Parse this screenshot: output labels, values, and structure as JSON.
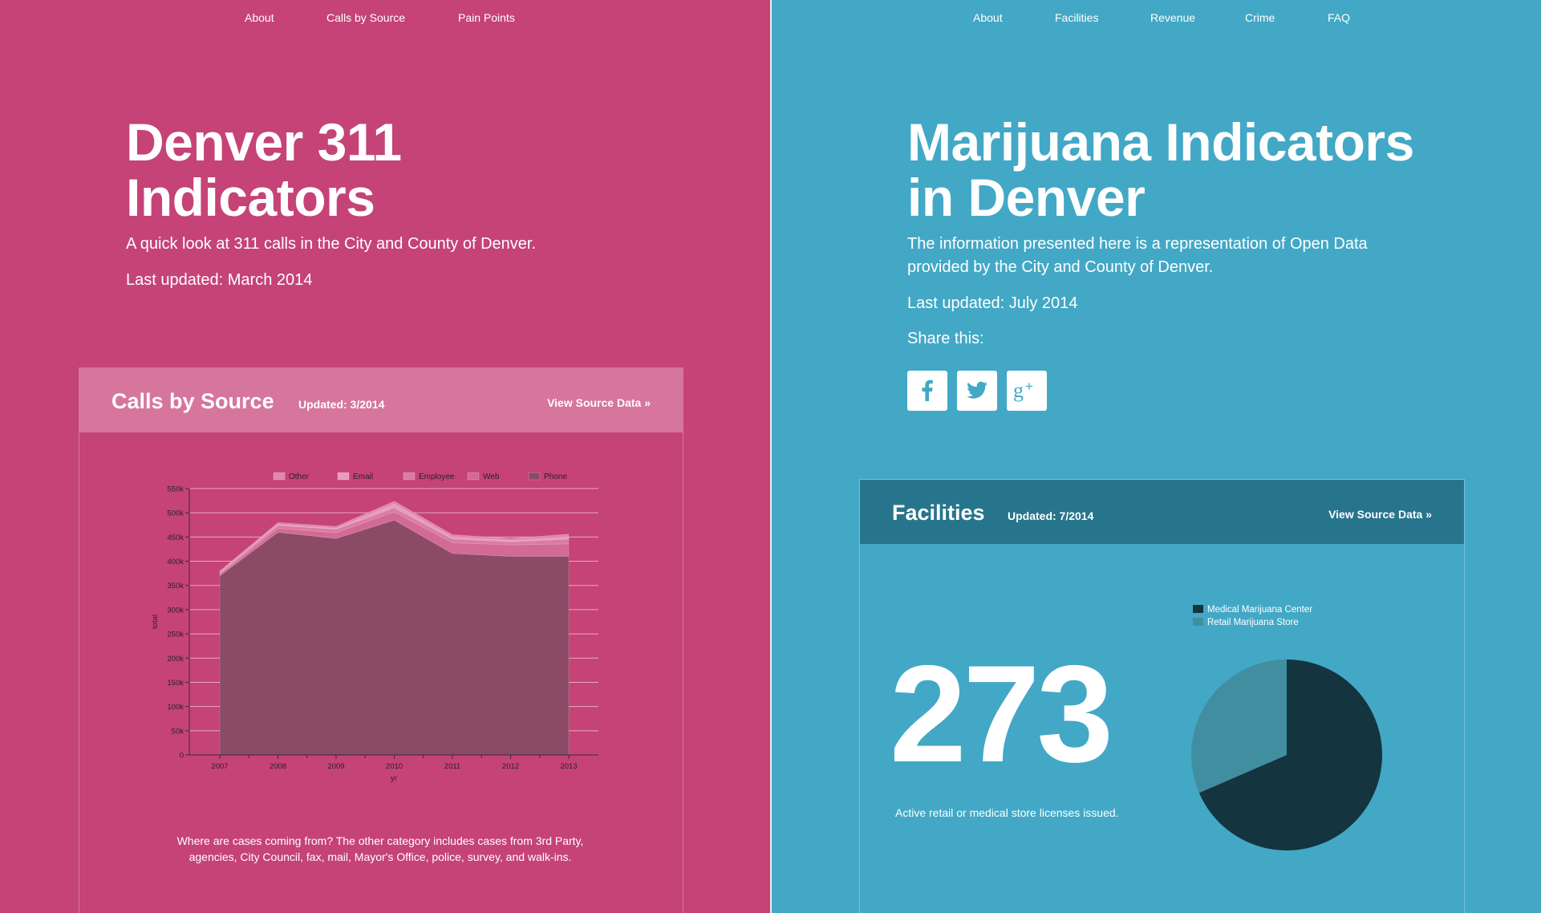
{
  "left": {
    "nav": [
      "About",
      "Calls by Source",
      "Pain Points"
    ],
    "title_line1": "Denver 311",
    "title_line2": "Indicators",
    "description": "A quick look at 311 calls in the City and County of Denver.",
    "last_updated": "Last updated: March 2014",
    "card": {
      "title": "Calls by Source",
      "updated": "Updated: 3/2014",
      "link": "View Source Data »",
      "caption": "Where are cases coming from? The other category includes cases from 3rd Party, agencies, City Council, fax, mail, Mayor's Office, police, survey, and walk-ins."
    }
  },
  "right": {
    "nav": [
      "About",
      "Facilities",
      "Revenue",
      "Crime",
      "FAQ"
    ],
    "title_line1": "Marijuana Indicators",
    "title_line2": "in Denver",
    "description": "The information presented here is a representation of Open Data provided by the City and County of Denver.",
    "last_updated": "Last updated: July 2014",
    "share_label": "Share this:",
    "share_buttons": [
      "facebook-icon",
      "twitter-icon",
      "google-plus-icon"
    ],
    "card": {
      "title": "Facilities",
      "updated": "Updated: 7/2014",
      "link": "View Source Data »",
      "big_number": "273",
      "big_number_caption": "Active retail or medical store licenses issued."
    }
  },
  "colors": {
    "left_bg": "#c54376",
    "right_bg": "#42a8c6",
    "left_card_header": "#d6769c",
    "right_card_header": "#27758c",
    "phone": "#8b4b65",
    "web": "#d36a95",
    "employee": "#da7ca1",
    "email": "#e79cbd",
    "other": "#de88ac",
    "medical": "#14343f",
    "retail": "#428ea1"
  },
  "chart_data": [
    {
      "type": "area",
      "stacked": true,
      "x": [
        "2007",
        "2008",
        "2009",
        "2010",
        "2011",
        "2012",
        "2013"
      ],
      "series": [
        {
          "name": "Phone",
          "values": [
            370000,
            460000,
            447000,
            485000,
            416000,
            410000,
            410000
          ]
        },
        {
          "name": "Web",
          "values": [
            3000,
            8000,
            12000,
            17000,
            22000,
            24000,
            26000
          ]
        },
        {
          "name": "Employee",
          "values": [
            3000,
            6000,
            7000,
            8000,
            8000,
            6000,
            10000
          ]
        },
        {
          "name": "Email",
          "values": [
            1000,
            2000,
            2000,
            8000,
            4000,
            3000,
            4000
          ]
        },
        {
          "name": "Other",
          "values": [
            3000,
            4000,
            4000,
            6000,
            5000,
            4000,
            6000
          ]
        }
      ],
      "legend_order": [
        "Other",
        "Email",
        "Employee",
        "Web",
        "Phone"
      ],
      "xlabel": "yr",
      "ylabel": "total",
      "ylim": [
        0,
        550000
      ],
      "yticks": [
        "0",
        "50k",
        "100k",
        "150k",
        "200k",
        "250k",
        "300k",
        "350k",
        "400k",
        "450k",
        "500k",
        "550k"
      ],
      "grid": true,
      "legend_position": "top"
    },
    {
      "type": "pie",
      "series": [
        {
          "name": "Medical Marijuana Center",
          "values": [
            187
          ]
        },
        {
          "name": "Retail Marijuana Store",
          "values": [
            86
          ]
        }
      ],
      "legend_position": "top-left"
    }
  ]
}
